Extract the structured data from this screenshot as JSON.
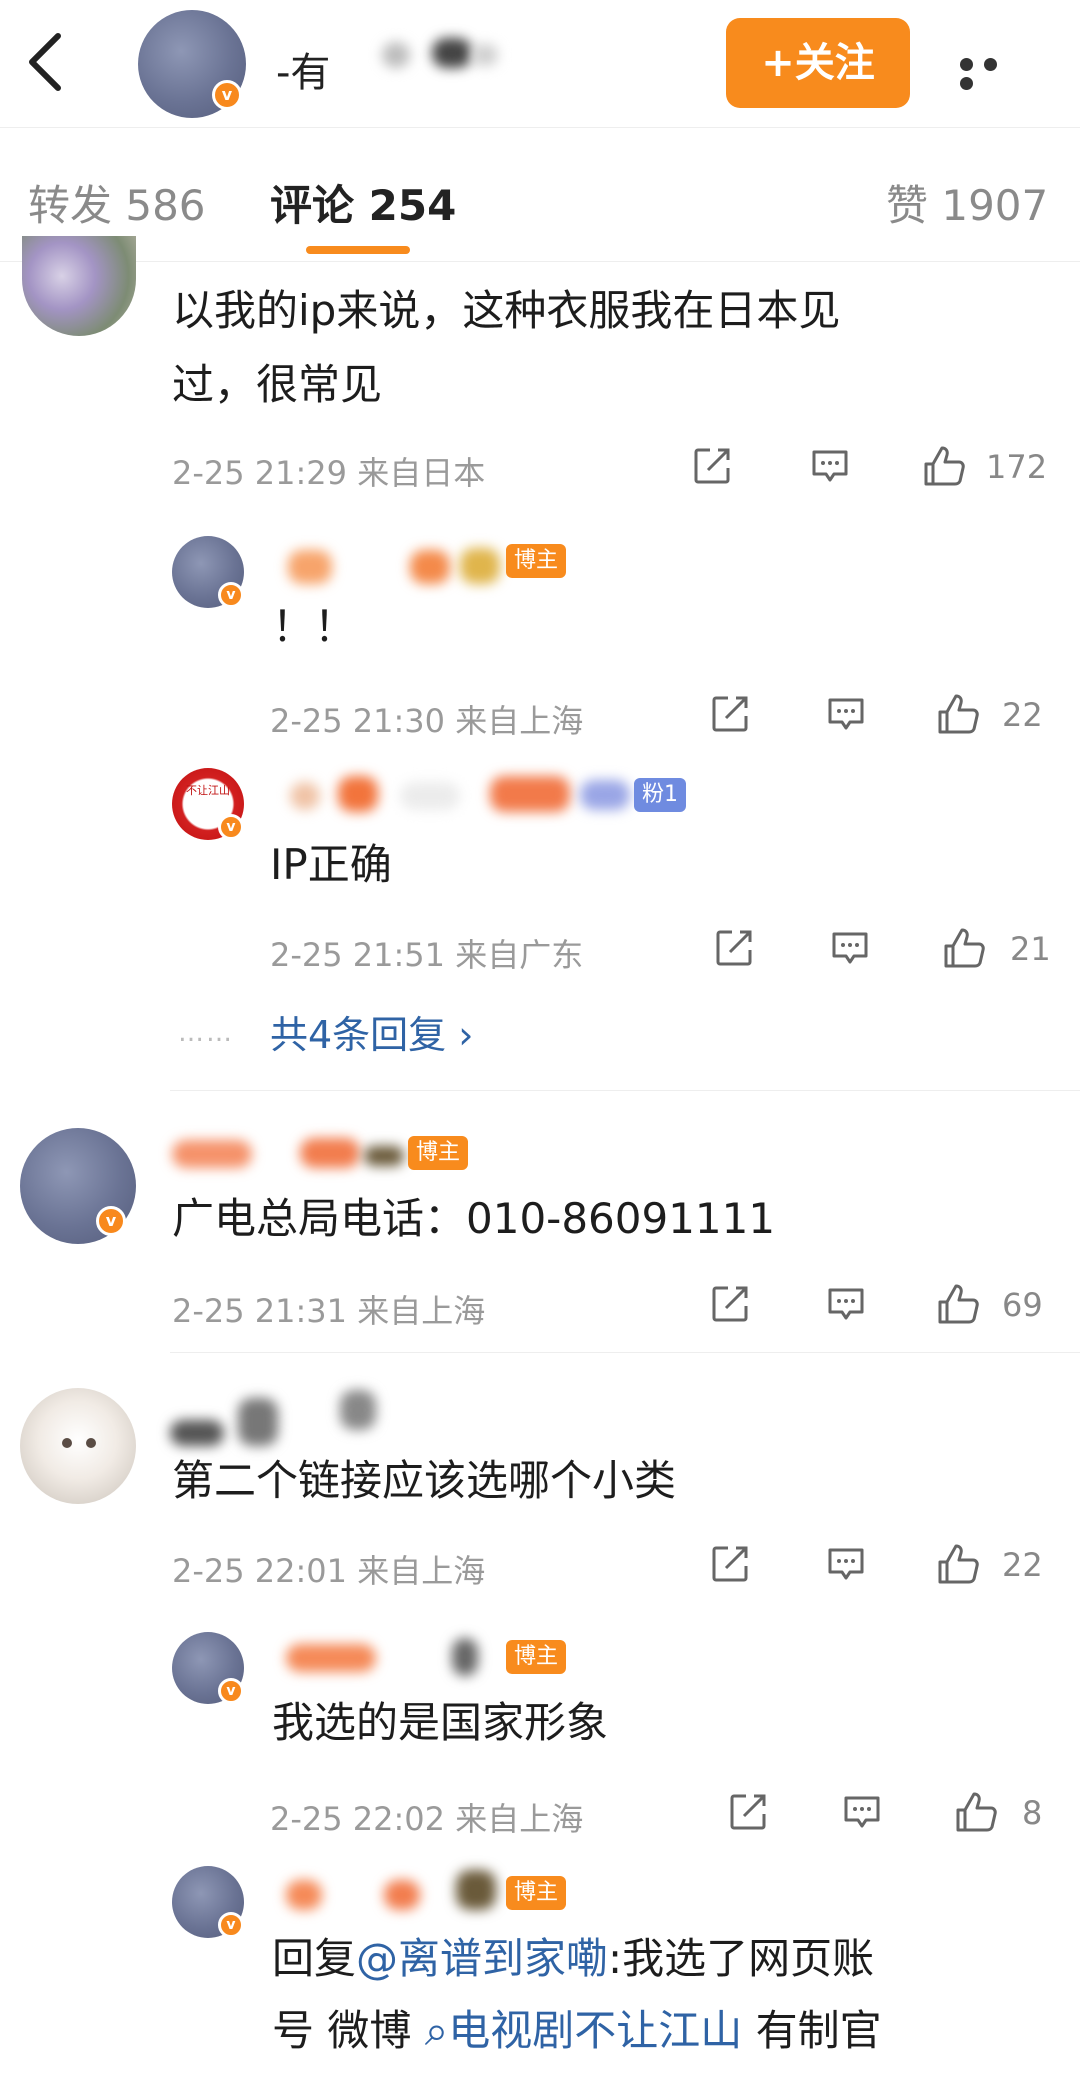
{
  "header": {
    "name_prefix": "-有",
    "follow_label": "+关注"
  },
  "tabs": [
    {
      "label": "转发 586"
    },
    {
      "label": "评论 254"
    },
    {
      "label": "赞 1907"
    }
  ],
  "comments": [
    {
      "text_line1": "以我的ip来说，这种衣服我在日本见",
      "text_line2": "过，很常见",
      "meta": "2-25 21:29  来自日本",
      "likes": "172",
      "replies": [
        {
          "badge": "博主",
          "text": "！！",
          "meta": "2-25 21:30  来自上海",
          "likes": "22"
        },
        {
          "badge": "粉1",
          "text": "IP正确",
          "meta": "2-25 21:51  来自广东",
          "likes": "21",
          "avatar_text": "不让江山"
        }
      ],
      "more_replies": "共4条回复 ›",
      "dots": "……"
    },
    {
      "badge": "博主",
      "text": "广电总局电话：010-86091111",
      "meta": "2-25 21:31  来自上海",
      "likes": "69"
    },
    {
      "text": "第二个链接应该选哪个小类",
      "meta": "2-25 22:01  来自上海",
      "likes": "22",
      "replies": [
        {
          "badge": "博主",
          "text": "我选的是国家形象",
          "meta": "2-25 22:02  来自上海",
          "likes": "8"
        },
        {
          "badge": "博主",
          "reply_prefix": "回复",
          "mention": "@离谱到家嘞",
          "text_after_mention": ":我选了网页账",
          "line2_start": "号 微博 ",
          "hashtag": "⌕电视剧不让江山",
          "line2_end": " 有制官"
        }
      ]
    }
  ],
  "icons": [
    "back-icon",
    "more-icon",
    "share-icon",
    "comment-icon",
    "like-icon",
    "verified-icon"
  ],
  "colors": {
    "accent": "#f88b1d",
    "link": "#2f63a5",
    "verified": "#f8891d"
  }
}
